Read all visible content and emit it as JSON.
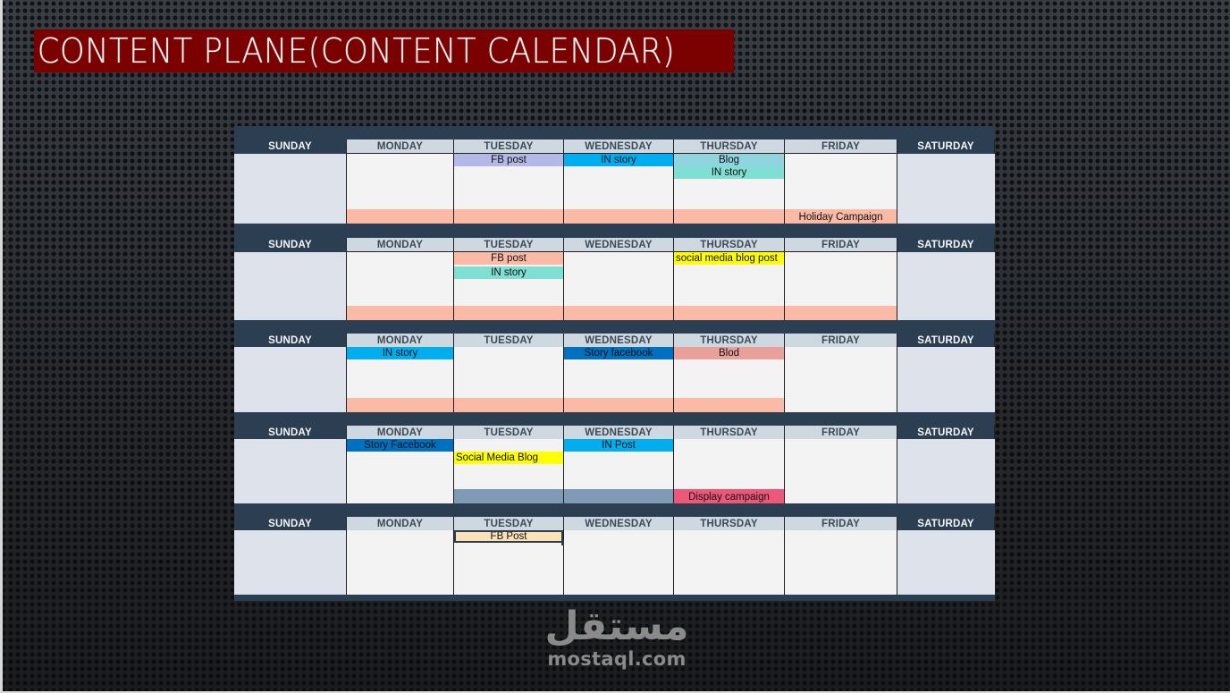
{
  "title": "CONTENT PLANE(CONTENT CALENDAR)",
  "colors": {
    "title_bg": "#7b0000",
    "header_dark": "#2c3e51",
    "header_light": "#ced8e0",
    "weekday_cell": "#f3f3f3",
    "weekend_cell": "#dee2ea",
    "peach": "#fbbaa6",
    "lavender": "#b4b8e6",
    "sky_blue": "#00aeef",
    "teal": "#7fdfd2",
    "yellow": "#ffff00",
    "dark_blue": "#0070c0",
    "rose": "#eaa09a",
    "slate_blue": "#7f9ab5",
    "pink_red": "#ed5878",
    "light_orange": "#fde0b4"
  },
  "days": [
    "SUNDAY",
    "MONDAY",
    "TUESDAY",
    "WEDNESDAY",
    "THURSDAY",
    "FRIDAY",
    "SATURDAY"
  ],
  "weeks": [
    {
      "entries": {
        "tuesday": [
          {
            "text": "FB post",
            "color": "#b4b8e6"
          }
        ],
        "wednesday": [
          {
            "text": "IN story",
            "color": "#00aeef"
          }
        ],
        "thursday": [
          {
            "text": "Blog",
            "color": "#8fd4df"
          },
          {
            "text": "IN story",
            "color": "#7fdfd2"
          }
        ]
      },
      "band": {
        "text": "Holiday Campaign",
        "color": "#fbbaa6",
        "span": "Monday–Friday"
      }
    },
    {
      "entries": {
        "tuesday": [
          {
            "text": "FB post",
            "color": "#fbbaa6"
          },
          {
            "text": "IN story",
            "color": "#7fdfd2"
          }
        ],
        "thursday": [
          {
            "text": "social media blog post",
            "color": "#ffff00"
          }
        ]
      },
      "band": {
        "text": "",
        "color": "#fbbaa6",
        "span": "Monday–Friday"
      }
    },
    {
      "entries": {
        "monday": [
          {
            "text": "IN story",
            "color": "#00aeef"
          }
        ],
        "wednesday": [
          {
            "text": "Story facebook",
            "color": "#0070c0"
          }
        ],
        "thursday": [
          {
            "text": "Blod",
            "color": "#eaa09a"
          }
        ]
      },
      "band": {
        "text": "",
        "color": "#fbbaa6",
        "span": "Monday–Thursday"
      }
    },
    {
      "entries": {
        "monday": [
          {
            "text": "Story Facebook",
            "color": "#0070c0"
          }
        ],
        "tuesday": [
          {
            "text": "Social Media Blog",
            "color": "#ffff00"
          }
        ],
        "wednesday": [
          {
            "text": "IN Post",
            "color": "#00aeef"
          }
        ]
      },
      "band": {
        "text": "Display campaign",
        "color": "#ed5878",
        "span": "Thursday",
        "pre_color": "#7f9ab5",
        "pre_span": "Tuesday–Wednesday"
      }
    },
    {
      "entries": {
        "tuesday": [
          {
            "text": "FB Post",
            "color": "#fde0b4",
            "selected": true
          }
        ]
      },
      "band": null
    }
  ],
  "watermark": {
    "arabic": "مستقل",
    "latin": "mostaql.com"
  }
}
